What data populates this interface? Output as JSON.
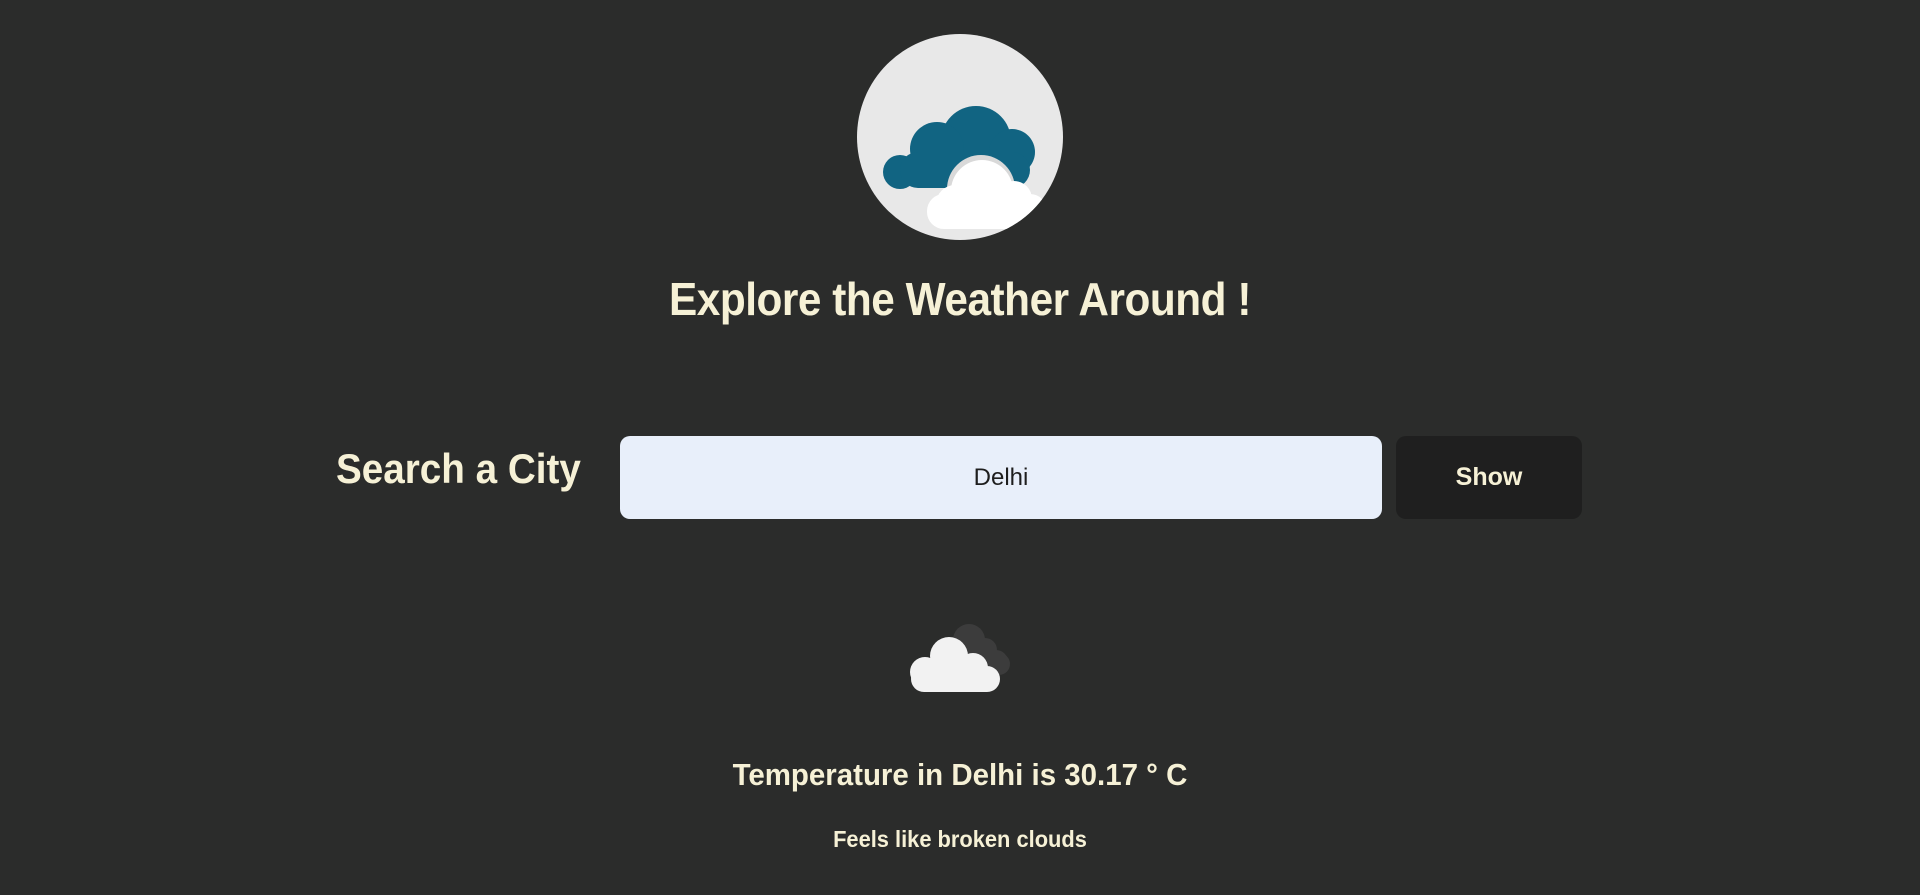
{
  "logo": {
    "icon": "cloud-logo-icon",
    "colors": {
      "circle": "#e8e8e8",
      "back_cloud": "#116482",
      "front_cloud": "#ffffff"
    }
  },
  "title": "Explore the Weather Around !",
  "search": {
    "label": "Search a City",
    "value": "Delhi",
    "placeholder": "",
    "button_label": "Show"
  },
  "weather": {
    "icon": "broken-clouds-icon",
    "temperature_prefix": "Temperature in",
    "city": "Delhi",
    "temperature_mid": "is",
    "temperature_value": "30.17",
    "temperature_unit": "° C",
    "feels_like_prefix": "Feels like",
    "description": "broken clouds"
  },
  "colors": {
    "background": "#2b2c2b",
    "text": "#f6f1d6",
    "input_bg": "#e8effa",
    "button_bg": "#1f1f1f"
  }
}
